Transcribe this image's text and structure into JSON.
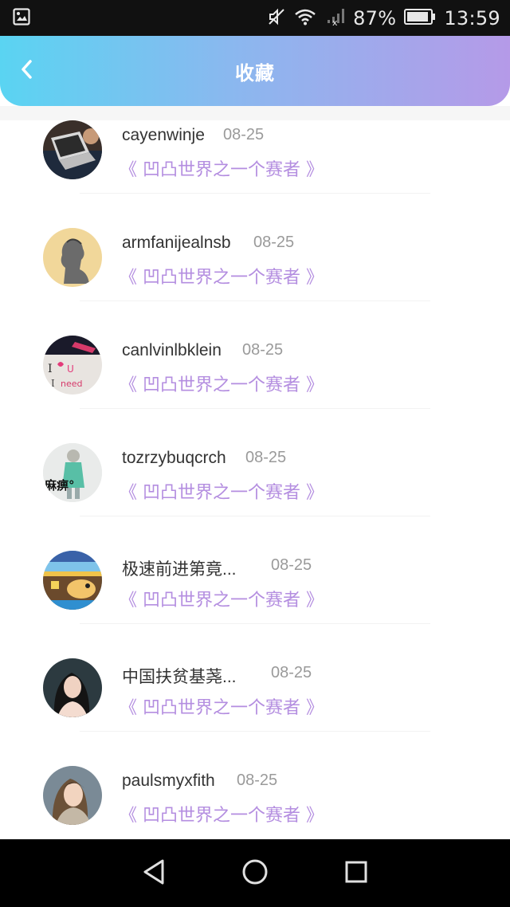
{
  "status_bar": {
    "battery_percent": "87%",
    "time": "13:59"
  },
  "header": {
    "title": "收藏"
  },
  "colors": {
    "accent_purple": "#b48ee0",
    "header_gradient_start": "#5ad4f2",
    "header_gradient_end": "#b59ae8"
  },
  "items": [
    {
      "username": "cayenwinje",
      "date": "08-25",
      "title": "《 凹凸世界之一个赛者 》",
      "avatar": "laptop-avatar"
    },
    {
      "username": "armfanijealnsb",
      "date": "08-25",
      "title": "《 凹凸世界之一个赛者 》",
      "avatar": "silhouette-avatar"
    },
    {
      "username": "canlvinlbklein",
      "date": "08-25",
      "title": "《 凹凸世界之一个赛者 》",
      "avatar": "letters-avatar"
    },
    {
      "username": "tozrzybuqcrch",
      "date": "08-25",
      "title": "《 凹凸世界之一个赛者 》",
      "avatar": "girl-text-avatar",
      "avatar_text": "麻痹°"
    },
    {
      "username": "极速前进第竟...",
      "date": "08-25",
      "title": "《 凹凸世界之一个赛者 》",
      "avatar": "cartoon-avatar"
    },
    {
      "username": "中国扶贫基荛...",
      "date": "08-25",
      "title": "《 凹凸世界之一个赛者 》",
      "avatar": "woman-avatar"
    },
    {
      "username": "paulsmyxfith",
      "date": "08-25",
      "title": "《 凹凸世界之一个赛者 》",
      "avatar": "blonde-avatar"
    }
  ],
  "nav_bar": {
    "icons": [
      "back-triangle-icon",
      "home-circle-icon",
      "recents-square-icon"
    ]
  }
}
